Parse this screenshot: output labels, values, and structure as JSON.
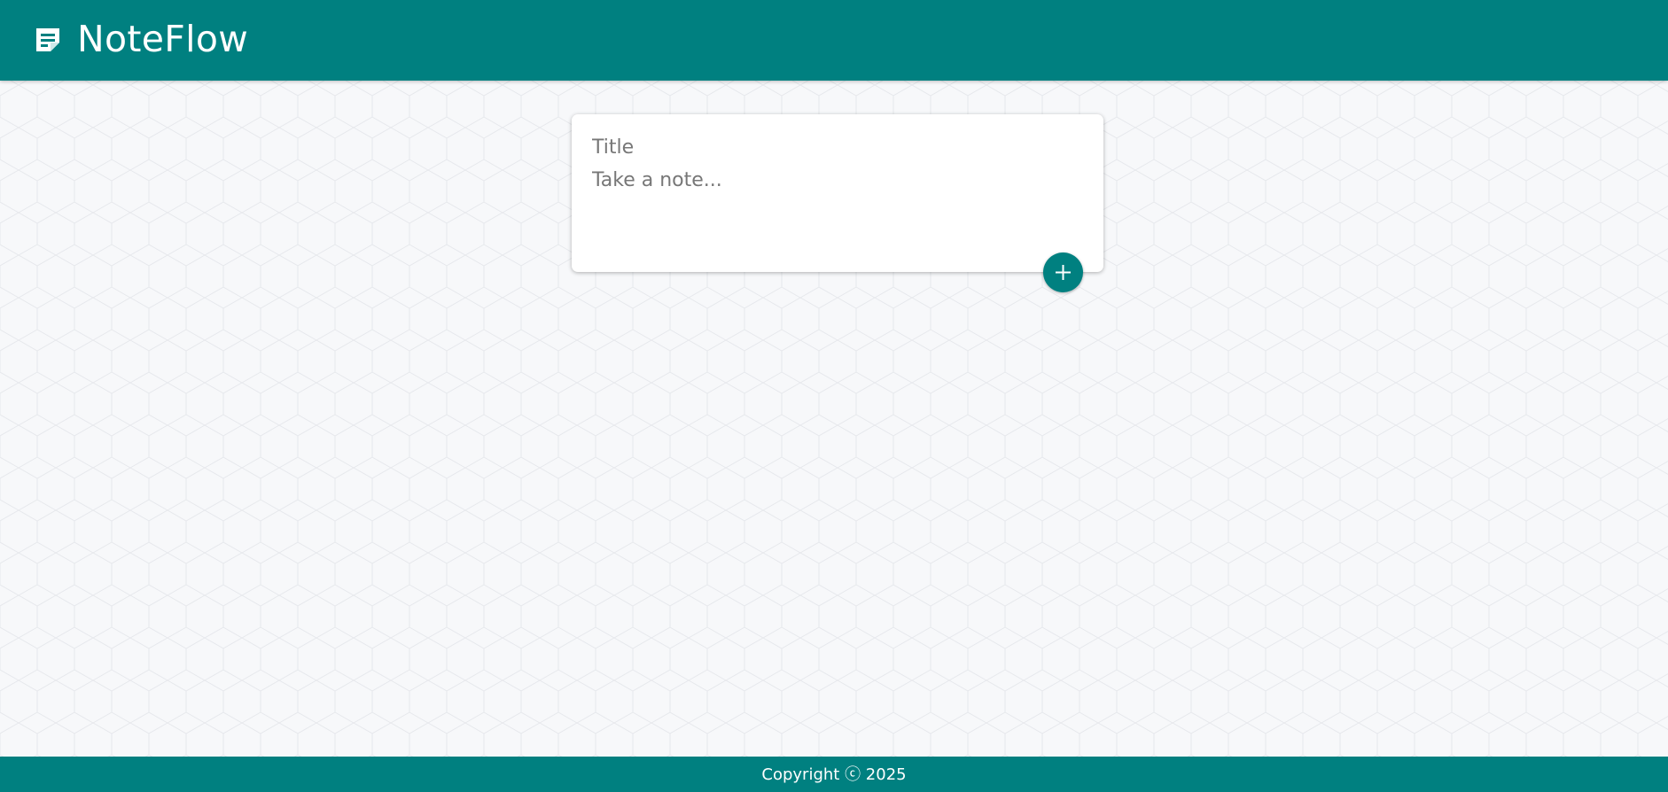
{
  "header": {
    "app_name": "NoteFlow",
    "logo_icon": "note-icon"
  },
  "create_note": {
    "title_placeholder": "Title",
    "content_placeholder": "Take a note...",
    "add_icon": "plus-icon"
  },
  "footer": {
    "copyright": "Copyright ⓒ 2025"
  },
  "colors": {
    "brand": "#008080",
    "background": "#f7f8fa",
    "card": "#ffffff"
  }
}
